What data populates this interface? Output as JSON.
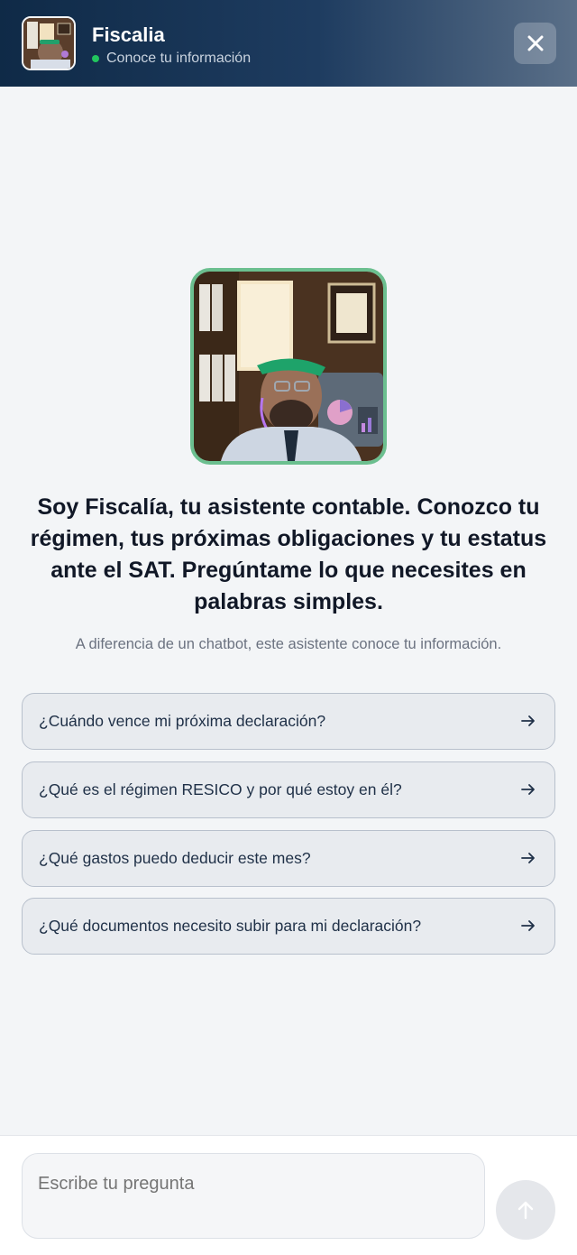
{
  "header": {
    "title": "Fiscalia",
    "status": "Conoce tu información",
    "status_color": "#22c55e",
    "close_icon": "close-icon"
  },
  "hero": {
    "image": "assistant-portrait",
    "headline": "Soy Fiscalía, tu asistente contable. Conozco tu régimen, tus próximas obligaciones y tu estatus ante el SAT. Pregúntame lo que necesites en palabras simples.",
    "subline": "A diferencia de un chatbot, este asistente conoce tu información."
  },
  "suggestions": [
    {
      "label": "¿Cuándo vence mi próxima declaración?",
      "icon": "arrow-right-icon"
    },
    {
      "label": "¿Qué es el régimen RESICO y por qué estoy en él?",
      "icon": "arrow-right-icon"
    },
    {
      "label": "¿Qué gastos puedo deducir este mes?",
      "icon": "arrow-right-icon"
    },
    {
      "label": "¿Qué documentos necesito subir para mi declaración?",
      "icon": "arrow-right-icon"
    }
  ],
  "composer": {
    "placeholder": "Escribe tu pregunta",
    "send_icon": "arrow-up-icon"
  },
  "colors": {
    "accent_border": "#6bbf8f",
    "header_dark": "#0f2a47"
  }
}
